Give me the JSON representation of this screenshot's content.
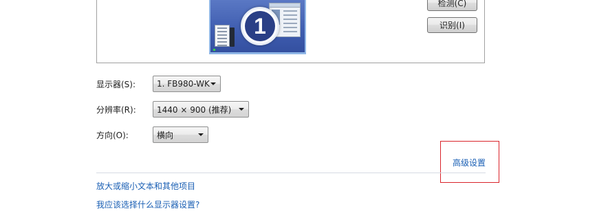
{
  "buttons": {
    "detect": "检测(C)",
    "identify": "识别(I)"
  },
  "preview": {
    "monitor_number": "1"
  },
  "display_row": {
    "label": "显示器(S):",
    "value": "1. FB980-WK"
  },
  "resolution_row": {
    "label": "分辨率(R):",
    "value": "1440 × 900 (推荐)"
  },
  "orientation_row": {
    "label": "方向(O):",
    "value": "横向"
  },
  "advanced_link": "高级设置",
  "links": {
    "text_size": "放大或缩小文本和其他项目",
    "which_settings": "我应该选择什么显示器设置?"
  },
  "colors": {
    "link": "#1a5fb4",
    "highlight": "#d9232a"
  }
}
